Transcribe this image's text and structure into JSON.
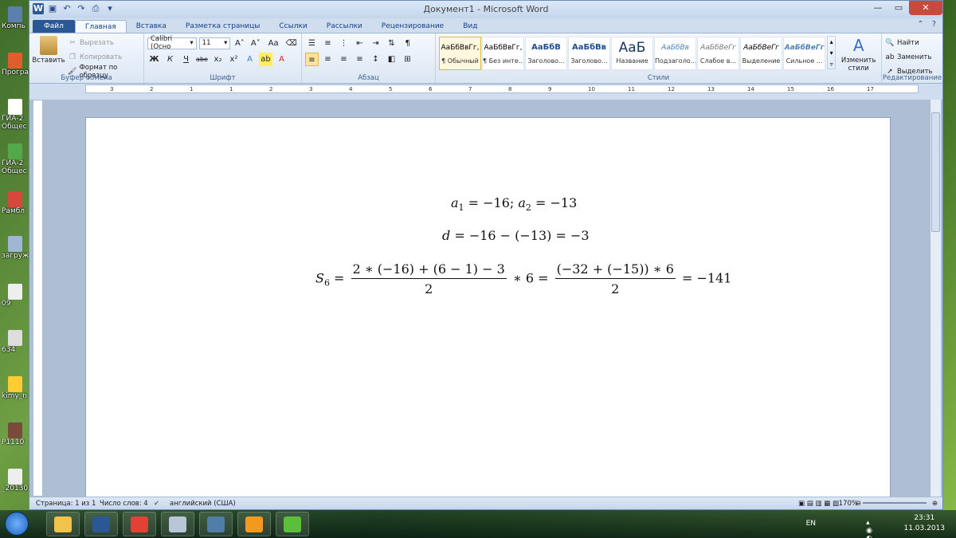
{
  "desktop": {
    "icons": [
      {
        "label": "Компь",
        "color": "#5b7fae"
      },
      {
        "label": "Програ",
        "color": "#e05d2c"
      },
      {
        "label": "ГИА-2",
        "label2": "Общес",
        "color": "#ffffff"
      },
      {
        "label": "ГИА-2",
        "label2": "Общес",
        "color": "#52a94a"
      },
      {
        "label": "Рамбл",
        "color": "#d9463b"
      },
      {
        "label": "загруж",
        "color": "#9fb6d4"
      },
      {
        "label": "09",
        "color": "#eeeeee"
      },
      {
        "label": "634",
        "color": "#dddddd"
      },
      {
        "label": "kimy_n",
        "color": "#ffcc33"
      },
      {
        "label": "P1110",
        "color": "#7a4a3a"
      },
      {
        "label": "_20130",
        "color": "#eeeeee"
      }
    ]
  },
  "window": {
    "title": "Документ1  -  Microsoft Word",
    "qat_icons": [
      "word-icon",
      "save-icon",
      "undo-icon",
      "redo-icon",
      "print-icon",
      "customize-icon"
    ]
  },
  "tabs": [
    "Файл",
    "Главная",
    "Вставка",
    "Разметка страницы",
    "Ссылки",
    "Рассылки",
    "Рецензирование",
    "Вид"
  ],
  "ribbon": {
    "clipboard": {
      "paste": "Вставить",
      "cut": "Вырезать",
      "copy": "Копировать",
      "format_painter": "Формат по образцу",
      "label": "Буфер обмена"
    },
    "font": {
      "name": "Calibri (Осно",
      "size": "11",
      "label": "Шрифт",
      "bold": "Ж",
      "italic": "К",
      "underline": "Ч",
      "strike": "abe",
      "sub": "x₂",
      "sup": "x²",
      "grow": "A˄",
      "shrink": "A˅",
      "case": "Aa",
      "color": "A"
    },
    "paragraph": {
      "label": "Абзац",
      "show_marks": "¶"
    },
    "styles": {
      "label": "Стили",
      "items": [
        {
          "sample": "АаБбВвГг,",
          "name": "¶ Обычный",
          "selected": true
        },
        {
          "sample": "АаБбВвГг,",
          "name": "¶ Без инте..."
        },
        {
          "sample": "АаБбВ",
          "name": "Заголово..."
        },
        {
          "sample": "АаБбВв",
          "name": "Заголово..."
        },
        {
          "sample": "АаБ",
          "name": "Название"
        },
        {
          "sample": "АаБбВв",
          "name": "Подзаголо..."
        },
        {
          "sample": "АаБбВеГг",
          "name": "Слабое в..."
        },
        {
          "sample": "АаБбВеГг",
          "name": "Выделение"
        },
        {
          "sample": "АаБбВеГг",
          "name": "Сильное ..."
        }
      ],
      "change_styles": "Изменить стили"
    },
    "editing": {
      "label": "Редактирование",
      "find": "Найти",
      "replace": "Заменить",
      "select": "Выделить"
    }
  },
  "ruler": {
    "ticks": [
      "3",
      "2",
      "1",
      "1",
      "2",
      "3",
      "4",
      "5",
      "6",
      "7",
      "8",
      "9",
      "10",
      "11",
      "12",
      "13",
      "14",
      "15",
      "16",
      "17"
    ]
  },
  "document": {
    "eq1": {
      "a1": "a",
      "a1_sub": "1",
      "eq1_rest": " = −16; ",
      "a2": "a",
      "a2_sub": "2",
      "eq2_rest": " = −13"
    },
    "eq2": {
      "d": "d",
      "rest": " = −16 − (−13) = −3"
    },
    "eq3": {
      "S": "S",
      "S_sub": "6",
      "eq": " = ",
      "frac1_num": "2 ∗ (−16) + (6 − 1) − 3",
      "frac1_den": "2",
      "mid": " ∗ 6 = ",
      "frac2_num": "(−32 + (−15)) ∗ 6",
      "frac2_den": "2",
      "result": " = −141"
    }
  },
  "status": {
    "page": "Страница: 1 из 1",
    "words": "Число слов: 4",
    "language": "английский (США)",
    "zoom": "170%"
  },
  "taskbar": {
    "apps": [
      {
        "name": "explorer",
        "color": "#f2c34a"
      },
      {
        "name": "word",
        "color": "#2b5797"
      },
      {
        "name": "chrome",
        "color": "#e34133"
      },
      {
        "name": "calculator",
        "color": "#b8c6d8"
      },
      {
        "name": "monitor",
        "color": "#4f7fa8"
      },
      {
        "name": "mail",
        "color": "#f39a1e"
      },
      {
        "name": "icq",
        "color": "#5bbf3a"
      }
    ],
    "lang": "EN",
    "time": "23:31",
    "date": "11.03.2013"
  }
}
